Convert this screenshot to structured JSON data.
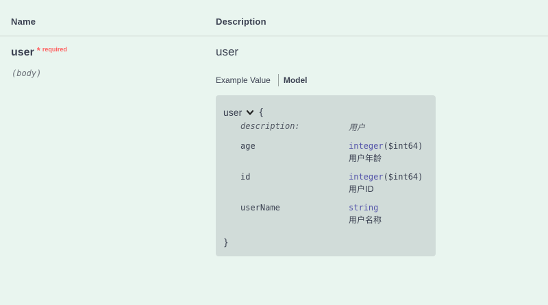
{
  "table": {
    "col_name": "Name",
    "col_description": "Description"
  },
  "param": {
    "name": "user",
    "required_star": "*",
    "required_label": "required",
    "in": "(body)"
  },
  "description": {
    "title": "user",
    "tab_example": "Example Value",
    "tab_model": "Model"
  },
  "model": {
    "title": "user",
    "open_brace": "{",
    "close_brace": "}",
    "description_key": "description:",
    "description_value": "用户",
    "properties": [
      {
        "name": "age",
        "type": "integer",
        "format": "($int64)",
        "desc": "用户年龄"
      },
      {
        "name": "id",
        "type": "integer",
        "format": "($int64)",
        "desc": "用户ID"
      },
      {
        "name": "userName",
        "type": "string",
        "format": "",
        "desc": "用户名称"
      }
    ]
  }
}
